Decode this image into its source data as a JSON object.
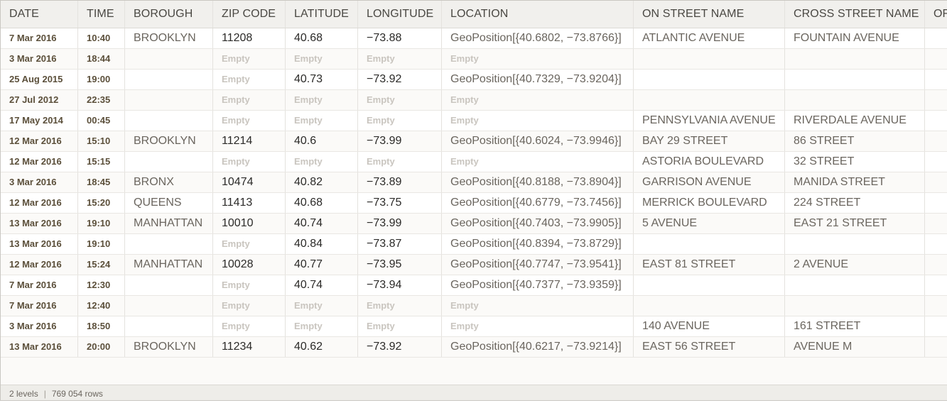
{
  "columns": [
    "DATE",
    "TIME",
    "BOROUGH",
    "ZIP CODE",
    "LATITUDE",
    "LONGITUDE",
    "LOCATION",
    "ON STREET NAME",
    "CROSS STREET NAME",
    "OF"
  ],
  "empty_label": "Empty",
  "rows": [
    [
      "7 Mar 2016",
      "10:40",
      "BROOKLYN",
      "11208",
      "40.68",
      "−73.88",
      "GeoPosition[{40.6802, −73.8766}]",
      "ATLANTIC AVENUE",
      "FOUNTAIN AVENUE"
    ],
    [
      "3 Mar 2016",
      "18:44",
      "",
      null,
      null,
      null,
      null,
      "",
      ""
    ],
    [
      "25 Aug 2015",
      "19:00",
      "",
      null,
      "40.73",
      "−73.92",
      "GeoPosition[{40.7329, −73.9204}]",
      "",
      ""
    ],
    [
      "27 Jul 2012",
      "22:35",
      "",
      null,
      null,
      null,
      null,
      "",
      ""
    ],
    [
      "17 May 2014",
      "00:45",
      "",
      null,
      null,
      null,
      null,
      "PENNSYLVANIA AVENUE",
      "RIVERDALE AVENUE"
    ],
    [
      "12 Mar 2016",
      "15:10",
      "BROOKLYN",
      "11214",
      "40.6",
      "−73.99",
      "GeoPosition[{40.6024, −73.9946}]",
      "BAY 29 STREET",
      "86 STREET"
    ],
    [
      "12 Mar 2016",
      "15:15",
      "",
      null,
      null,
      null,
      null,
      "ASTORIA BOULEVARD",
      "32 STREET"
    ],
    [
      "3 Mar 2016",
      "18:45",
      "BRONX",
      "10474",
      "40.82",
      "−73.89",
      "GeoPosition[{40.8188, −73.8904}]",
      "GARRISON AVENUE",
      "MANIDA STREET"
    ],
    [
      "12 Mar 2016",
      "15:20",
      "QUEENS",
      "11413",
      "40.68",
      "−73.75",
      "GeoPosition[{40.6779, −73.7456}]",
      "MERRICK BOULEVARD",
      "224 STREET"
    ],
    [
      "13 Mar 2016",
      "19:10",
      "MANHATTAN",
      "10010",
      "40.74",
      "−73.99",
      "GeoPosition[{40.7403, −73.9905}]",
      "5 AVENUE",
      "EAST 21 STREET"
    ],
    [
      "13 Mar 2016",
      "19:10",
      "",
      null,
      "40.84",
      "−73.87",
      "GeoPosition[{40.8394, −73.8729}]",
      "",
      ""
    ],
    [
      "12 Mar 2016",
      "15:24",
      "MANHATTAN",
      "10028",
      "40.77",
      "−73.95",
      "GeoPosition[{40.7747, −73.9541}]",
      "EAST 81 STREET",
      "2 AVENUE"
    ],
    [
      "7 Mar 2016",
      "12:30",
      "",
      null,
      "40.74",
      "−73.94",
      "GeoPosition[{40.7377, −73.9359}]",
      "",
      ""
    ],
    [
      "7 Mar 2016",
      "12:40",
      "",
      null,
      null,
      null,
      null,
      "",
      ""
    ],
    [
      "3 Mar 2016",
      "18:50",
      "",
      null,
      null,
      null,
      null,
      "140 AVENUE",
      "161 STREET"
    ],
    [
      "13 Mar 2016",
      "20:00",
      "BROOKLYN",
      "11234",
      "40.62",
      "−73.92",
      "GeoPosition[{40.6217, −73.9214}]",
      "EAST 56 STREET",
      "AVENUE M"
    ]
  ],
  "footer": {
    "levels": "2 levels",
    "rows": "769 054 rows"
  }
}
